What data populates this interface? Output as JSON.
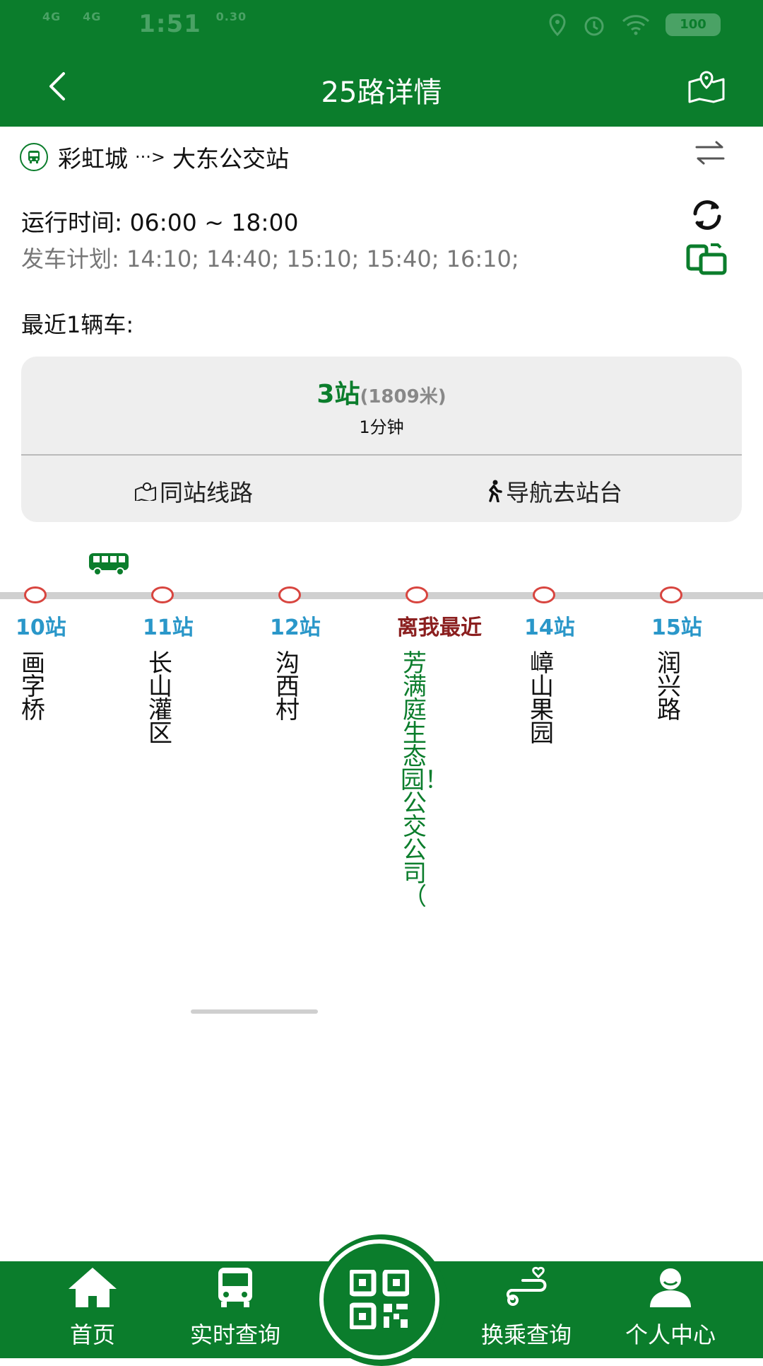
{
  "status": {
    "time": "1:51",
    "net1": "4G",
    "net2": "4G",
    "speed": "0.30",
    "battery": "100"
  },
  "header": {
    "title": "25路详情",
    "back_icon": "chevron-left-icon",
    "map_icon": "map-pin-icon"
  },
  "route": {
    "from": "彩虹城",
    "arrow": "···>",
    "to": "大东公交站"
  },
  "schedule": {
    "operating_time": "运行时间: 06:00 ~ 18:00",
    "departure_plan": "发车计划: 14:10; 14:40; 15:10; 15:40; 16:10;"
  },
  "recent_label": "最近1辆车:",
  "vehicle_card": {
    "stops": "3站",
    "distance": "(1809米)",
    "eta": "1分钟",
    "same_station_routes": "同站线路",
    "navigate_to_stop": "导航去站台"
  },
  "stations": [
    {
      "num": "10站",
      "name": "画字桥"
    },
    {
      "num": "11站",
      "name": "长山灌区"
    },
    {
      "num": "12站",
      "name": "沟西村"
    },
    {
      "num": "离我最近",
      "name": "芳满庭生态园！公交公司（"
    },
    {
      "num": "14站",
      "name": "嶂山果园"
    },
    {
      "num": "15站",
      "name": "润兴路"
    }
  ],
  "nav": {
    "home": "首页",
    "realtime": "实时查询",
    "transfer": "换乘查询",
    "profile": "个人中心"
  },
  "colors": {
    "brand": "#0b7d2c",
    "stop_num": "#2a97c9",
    "nearest": "#8b1f1f",
    "node": "#d8453f"
  }
}
